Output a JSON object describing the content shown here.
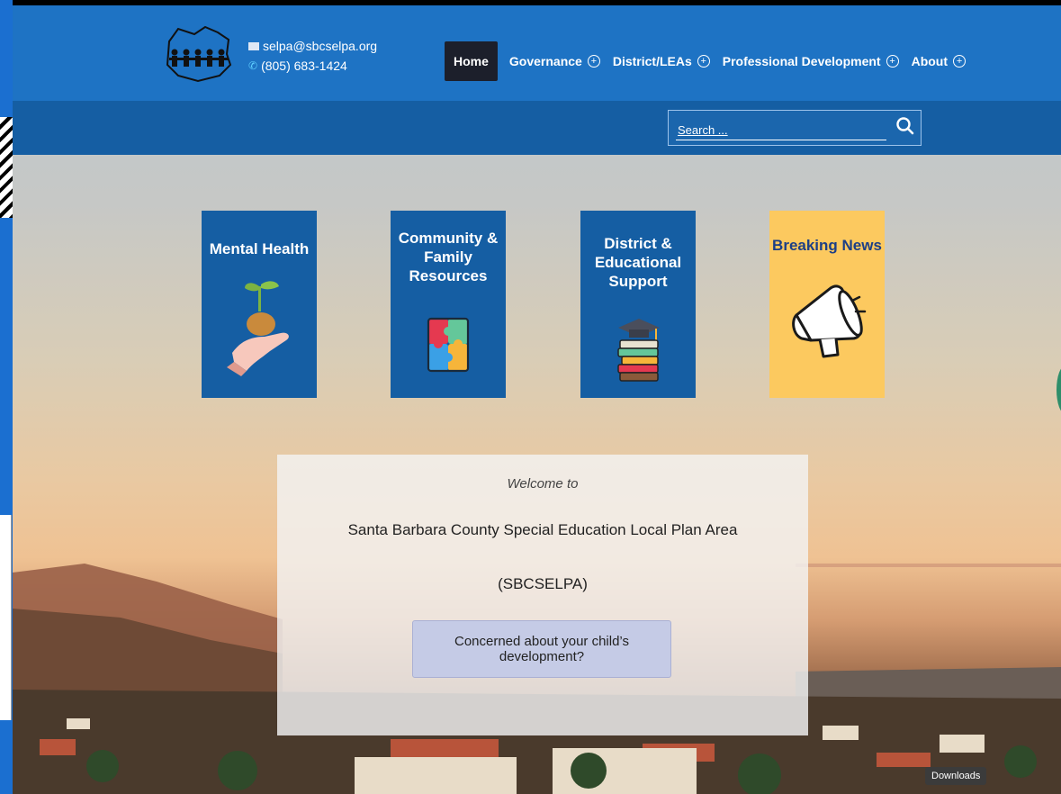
{
  "header": {
    "email": "selpa@sbcselpa.org",
    "phone": "(805) 683-1424",
    "nav": [
      {
        "label": "Home",
        "active": true
      },
      {
        "label": "Governance"
      },
      {
        "label": "District/LEAs"
      },
      {
        "label": "Professional Development"
      },
      {
        "label": "About"
      }
    ]
  },
  "search": {
    "placeholder": "Search ..."
  },
  "tiles": [
    {
      "label": "Mental Health",
      "icon": "hand-seedling-icon"
    },
    {
      "label": "Community & Family Resources",
      "icon": "puzzle-icon"
    },
    {
      "label": "District & Educational Support",
      "icon": "books-graduation-cap-icon"
    },
    {
      "label": "Breaking News",
      "icon": "megaphone-icon"
    }
  ],
  "welcome": {
    "intro": "Welcome to",
    "name": "Santa Barbara County Special Education Local Plan Area",
    "abbr": "(SBCSELPA)",
    "cta": "Concerned about your child’s development?"
  },
  "overlay": {
    "downloads": "Downloads"
  },
  "colors": {
    "header": "#1e73c4",
    "subbar": "#155ea3",
    "tile": "#155ea3",
    "news_tile": "#fcc95f",
    "active_nav": "#1c1f2b"
  }
}
